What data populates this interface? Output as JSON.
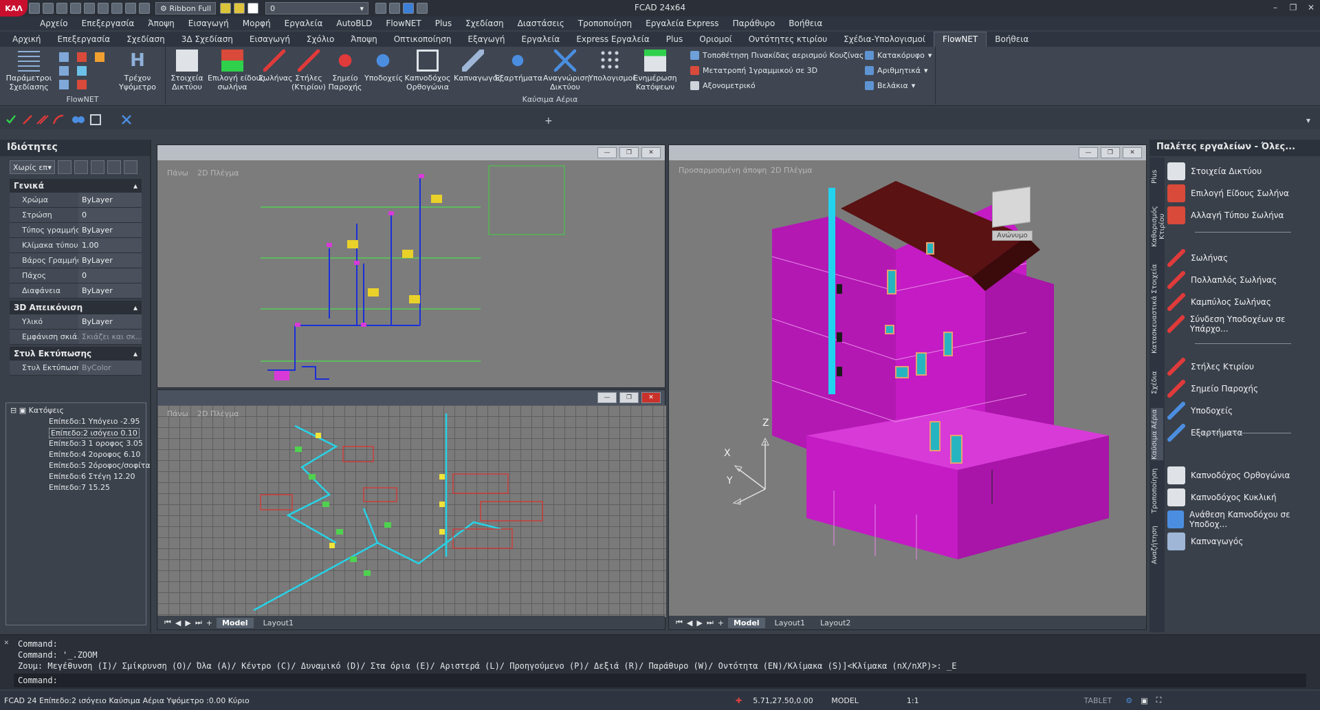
{
  "app": {
    "title": "FCAD 24x64",
    "logo_text": "ΚΑΛ",
    "ribbon_combo": "Ribbon Full",
    "layer_combo": "0"
  },
  "menu": [
    "Αρχείο",
    "Επεξεργασία",
    "Άποψη",
    "Εισαγωγή",
    "Μορφή",
    "Εργαλεία",
    "AutoBLD",
    "FlowNET",
    "Plus",
    "Σχεδίαση",
    "Διαστάσεις",
    "Τροποποίηση",
    "Εργαλεία Express",
    "Παράθυρο",
    "Βοήθεια"
  ],
  "ribbon_tabs": [
    "Αρχική",
    "Επεξεργασία",
    "Σχεδίαση",
    "3Δ Σχεδίαση",
    "Εισαγωγή",
    "Σχόλιο",
    "Άποψη",
    "Οπτικοποίηση",
    "Εξαγωγή",
    "Εργαλεία",
    "Express Εργαλεία",
    "Plus",
    "Οριομοί",
    "Οντότητες κτιρίου",
    "Σχέδια-Υπολογισμοί",
    "FlowNET",
    "Βοήθεια"
  ],
  "ribbon_active_tab": "FlowNET",
  "ribbon": {
    "flownet_panel": {
      "params": "Παράμετροι\nΣχεδίασης",
      "current": "Τρέχον\nΥψόμετρο",
      "label": "FlowNET"
    },
    "gas_panel": {
      "label": "Καύσιμα Αέρια",
      "buttons": [
        "Στοιχεία\nΔικτύου",
        "Επιλογή είδους\nσωλήνα",
        "Σωλήνας",
        "Στήλες\n(Κτιρίου)",
        "Σημείο\nΠαροχής",
        "Υποδοχείς",
        "Καπνοδόχος\nΟρθογώνια",
        "Καπναγωγός",
        "Εξαρτήματα",
        "Αναγνώριση\nΔικτύου",
        "Υπολογισμοί",
        "Ενημέρωση\nΚατόψεων"
      ]
    },
    "small": [
      "Τοποθέτηση Πινακίδας αερισμού Κουζίνας",
      "Μετατροπή 1γραμμικού σε 3D",
      "Αξονομετρικό",
      "Κατακόρυφο",
      "Αριθμητικά",
      "Βελάκια"
    ]
  },
  "properties": {
    "title": "Ιδιότητες",
    "selector": "Χωρίς επ",
    "sections": [
      {
        "name": "Γενικά",
        "rows": [
          [
            "Χρώμα",
            "ByLayer"
          ],
          [
            "Στρώση",
            "0"
          ],
          [
            "Τύπος γραμμής",
            "ByLayer"
          ],
          [
            "Κλίμακα τύπου ...",
            "1.00"
          ],
          [
            "Βάρος Γραμμής",
            "ByLayer"
          ],
          [
            "Πάχος",
            "0"
          ],
          [
            "Διαφάνεια",
            "ByLayer"
          ]
        ]
      },
      {
        "name": "3D Απεικόνιση",
        "rows": [
          [
            "Υλικό",
            "ByLayer"
          ],
          [
            "Εμφάνιση σκιά...",
            "Σκιάζει και σκ..."
          ]
        ]
      },
      {
        "name": "Στυλ Εκτύπωσης",
        "rows": [
          [
            "Στυλ Εκτύπωσης",
            "ByColor"
          ]
        ]
      }
    ]
  },
  "tree": {
    "root": "Κατόψεις",
    "items": [
      "Επίπεδο:1 Υπόγειο -2.95",
      "Επίπεδο:2 ισόγειο 0.10",
      "Επίπεδο:3 1 οροφος 3.05",
      "Επίπεδο:4 2οροφος 6.10",
      "Επίπεδο:5 2όροφος/σοφίτα",
      "Επίπεδο:6 Στέγη 12.20",
      "Επίπεδο:7  15.25"
    ],
    "selected": 1
  },
  "viewports": {
    "vp1": {
      "labels": [
        "Πάνω",
        "2D Πλέγμα"
      ]
    },
    "vp2": {
      "labels": [
        "Πάνω",
        "2D Πλέγμα"
      ],
      "tabs": [
        "Model",
        "Layout1"
      ]
    },
    "vp3": {
      "labels": [
        "Προσαρμοσμένη άποψη",
        "2D Πλέγμα"
      ],
      "tabs": [
        "Model",
        "Layout1",
        "Layout2"
      ],
      "cube_label": "Ανώνυμο",
      "axes": [
        "Z",
        "X",
        "Y"
      ]
    }
  },
  "palettes": {
    "title": "Παλέτες εργαλείων - Όλες...",
    "side_tabs": [
      "Plus",
      "Καθορισμός Κτιρίου",
      "Κατασκευαστικά Στοιχεία",
      "Σχέδια",
      "Καύσιμα Αέρια",
      "Τροποποίηση",
      "Αναζήτηση"
    ],
    "items": [
      "Στοιχεία Δικτύου",
      "Επιλογή Είδους Σωλήνα",
      "Αλλαγή Τύπου Σωλήνα",
      "Σωλήνας",
      "Πολλαπλός Σωλήνας",
      "Καμπύλος Σωλήνας",
      "Σύνδεση Υποδοχέων σε Υπάρχο...",
      "Στήλες Κτιρίου",
      "Σημείο Παροχής",
      "Υποδοχείς",
      "Εξαρτήματα",
      "Καπνοδόχος Ορθογώνια",
      "Καπνοδόχος Κυκλική",
      "Ανάθεση Καπνοδόχου σε Υποδοχ...",
      "Καπναγωγός"
    ]
  },
  "command": {
    "lines": [
      "Command:",
      "Command: '_.ZOOM",
      "Ζουμ:  Μεγέθυνση (I)/ Σμίκρυνση (O)/ Όλα (A)/ Κέντρο (C)/ Δυναμικό (D)/ Στα όρια (E)/ Αριστερά (L)/ Προηγούμενο (P)/ Δεξιά (R)/ Παράθυρο (W)/ Οντότητα (EN)/Κλίμακα (S)]<Κλίμακα (nX/nXP)>: _E"
    ],
    "prompt": "Command:"
  },
  "status": {
    "left": "FCAD 24 Επίπεδο:2 ισόγειο Καύσιμα Αέρια Υψόμετρο :0.00 Κύριο",
    "coords": "5.71,27.50,0.00",
    "model": "MODEL",
    "scale": "1:1",
    "tablet": "TABLET"
  },
  "colors": {
    "magenta": "#c41bc4",
    "cyan": "#22d3f0",
    "roof": "#5a1212"
  }
}
